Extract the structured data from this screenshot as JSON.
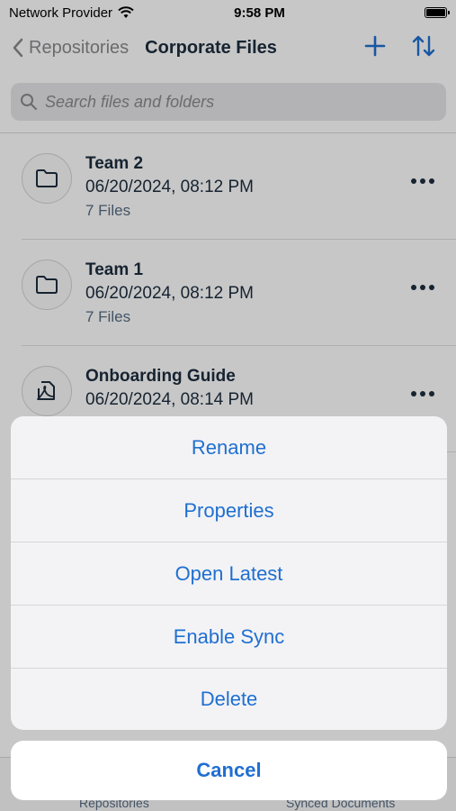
{
  "status": {
    "carrier": "Network Provider",
    "time": "9:58 PM"
  },
  "nav": {
    "back_label": "Repositories",
    "title": "Corporate Files"
  },
  "search": {
    "placeholder": "Search files and folders"
  },
  "items": [
    {
      "name": "Team 2",
      "date": "06/20/2024, 08:12 PM",
      "count": "7 Files",
      "icon": "folder-icon"
    },
    {
      "name": "Team 1",
      "date": "06/20/2024, 08:12 PM",
      "count": "7 Files",
      "icon": "folder-icon"
    },
    {
      "name": "Onboarding Guide",
      "date": "06/20/2024, 08:14 PM",
      "count": "",
      "icon": "pdf-document-icon"
    }
  ],
  "action_sheet": {
    "actions": [
      "Rename",
      "Properties",
      "Open Latest",
      "Enable Sync",
      "Delete"
    ],
    "cancel_label": "Cancel"
  },
  "tabs": [
    "Repositories",
    "Synced Documents"
  ],
  "colors": {
    "accent": "#1f6fd1",
    "title": "#1d2d3e",
    "secondary": "#556b82"
  }
}
